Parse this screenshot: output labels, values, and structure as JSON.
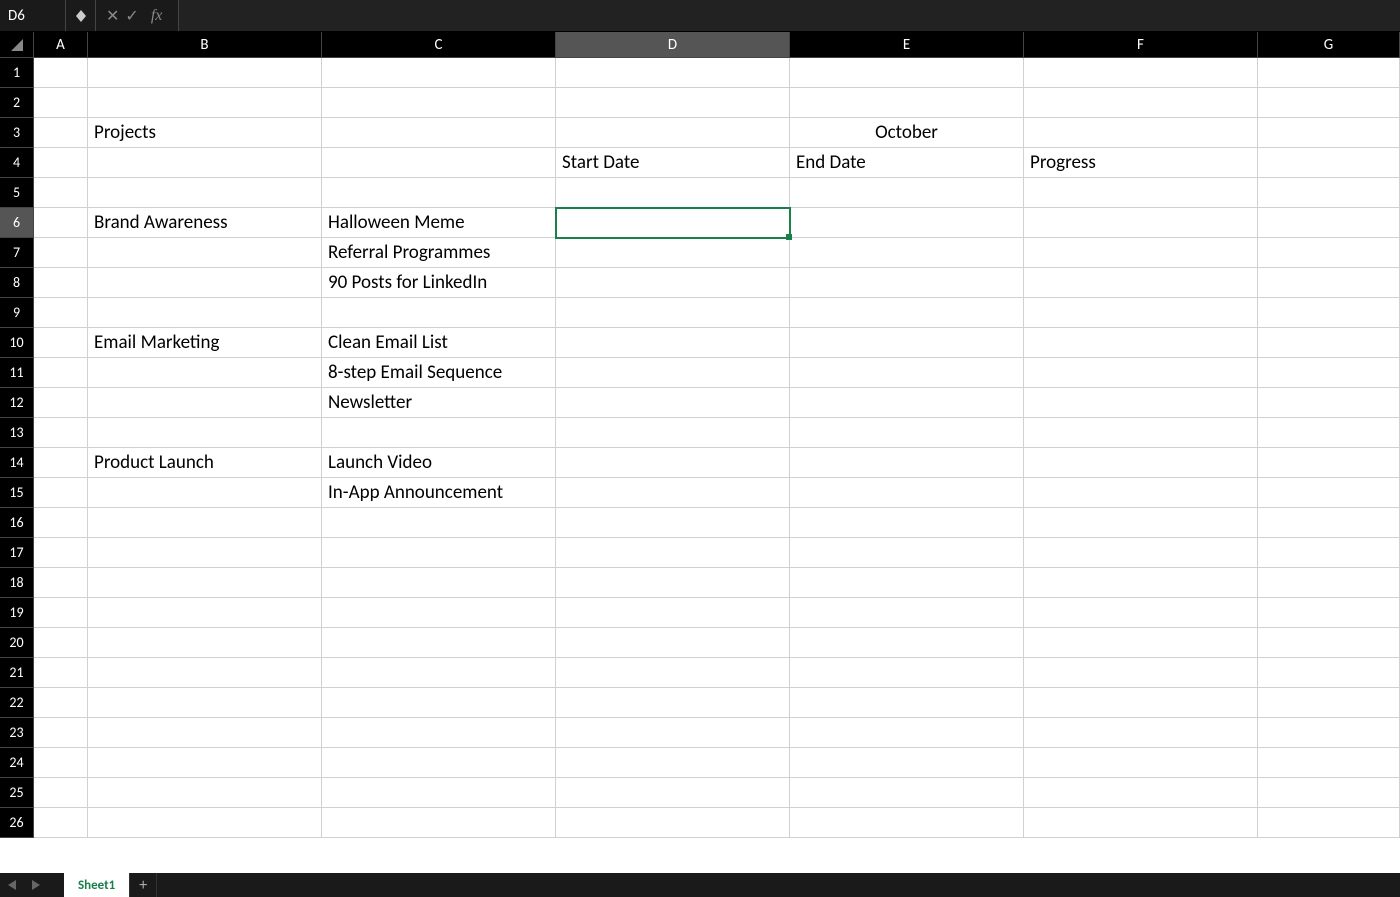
{
  "formula_bar": {
    "cell_ref": "D6",
    "fx_label": "fx",
    "formula_value": ""
  },
  "columns": [
    "A",
    "B",
    "C",
    "D",
    "E",
    "F",
    "G"
  ],
  "selected_col": "D",
  "selected_row": 6,
  "row_count": 26,
  "cells": {
    "B3": "Projects",
    "E3": "October",
    "D4": "Start Date",
    "E4": "End Date",
    "F4": "Progress",
    "B6": "Brand Awareness",
    "C6": "Halloween Meme",
    "C7": "Referral Programmes",
    "C8": "90 Posts for LinkedIn",
    "B10": "Email Marketing",
    "C10": "Clean Email List",
    "C11": "8-step Email Sequence",
    "C12": "Newsletter",
    "B14": "Product Launch",
    "C14": "Launch Video",
    "C15": "In-App Announcement"
  },
  "centered_cells": [
    "E3"
  ],
  "sheet_tabs": {
    "active": "Sheet1"
  }
}
